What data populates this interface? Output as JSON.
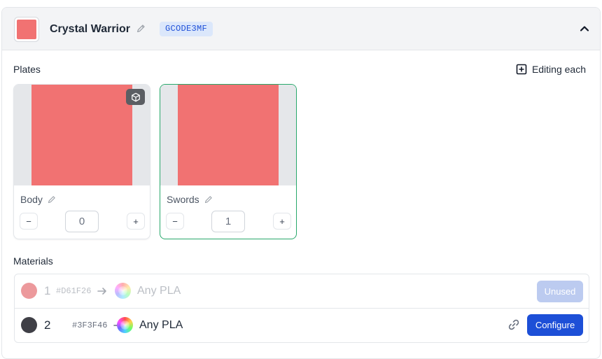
{
  "header": {
    "title": "Crystal Warrior",
    "code": "GCODE3MF",
    "swatch_color": "#F17272"
  },
  "plates_section": {
    "label": "Plates",
    "editing_label": "Editing each",
    "plates": [
      {
        "name": "Body",
        "quantity": "0",
        "minus": "−",
        "plus": "+",
        "color": "#F17272",
        "selected": false
      },
      {
        "name": "Swords",
        "quantity": "1",
        "minus": "−",
        "plus": "+",
        "color": "#F17272",
        "selected": true
      }
    ]
  },
  "materials_section": {
    "label": "Materials",
    "items": [
      {
        "index": "1",
        "hex": "#D61F26",
        "name": "Any PLA",
        "action": "Unused",
        "dot_color": "#D61F26",
        "status": "unused"
      },
      {
        "index": "2",
        "hex": "#3F3F46",
        "name": "Any PLA",
        "action": "Configure",
        "dot_color": "#3F3F46",
        "status": "configure"
      }
    ]
  }
}
